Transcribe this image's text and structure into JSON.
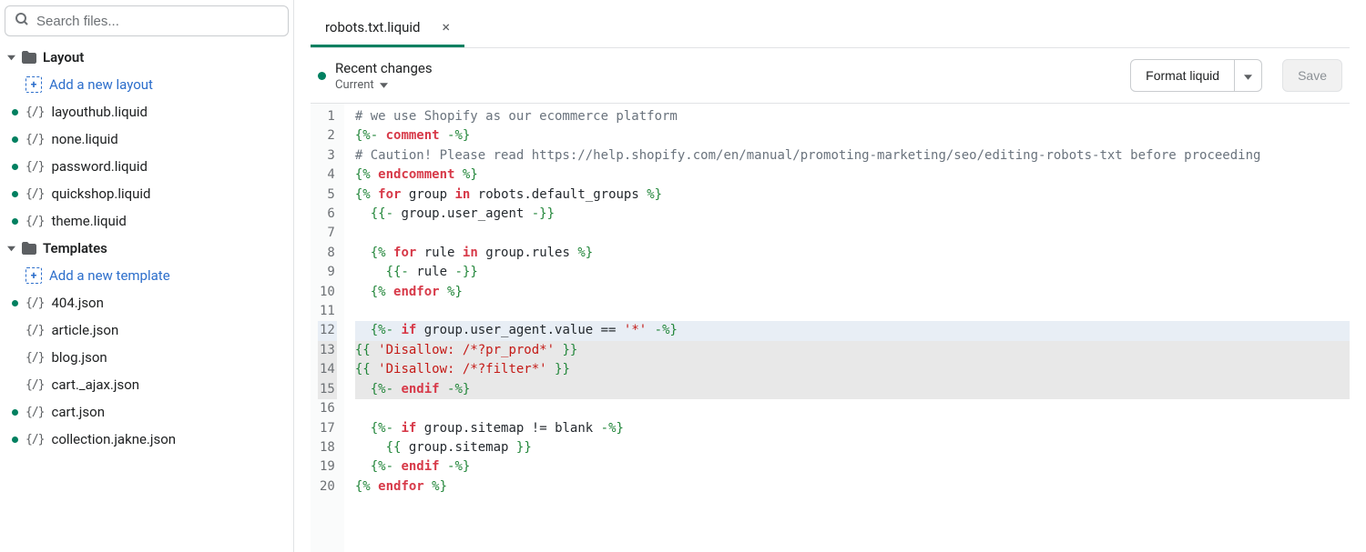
{
  "search": {
    "placeholder": "Search files..."
  },
  "sidebar": {
    "groups": [
      {
        "title": "Layout",
        "add_label": "Add a new layout",
        "items": [
          {
            "label": "layouthub.liquid",
            "modified": true
          },
          {
            "label": "none.liquid",
            "modified": true
          },
          {
            "label": "password.liquid",
            "modified": true
          },
          {
            "label": "quickshop.liquid",
            "modified": true
          },
          {
            "label": "theme.liquid",
            "modified": true
          }
        ]
      },
      {
        "title": "Templates",
        "add_label": "Add a new template",
        "items": [
          {
            "label": "404.json",
            "modified": true
          },
          {
            "label": "article.json",
            "modified": false
          },
          {
            "label": "blog.json",
            "modified": false
          },
          {
            "label": "cart._ajax.json",
            "modified": false
          },
          {
            "label": "cart.json",
            "modified": true
          },
          {
            "label": "collection.jakne.json",
            "modified": true
          }
        ]
      }
    ]
  },
  "tab": {
    "label": "robots.txt.liquid"
  },
  "toolbar": {
    "changes_label": "Recent changes",
    "version_label": "Current",
    "format_label": "Format liquid",
    "save_label": "Save"
  },
  "code": {
    "start_line": 1,
    "highlighted": [
      12
    ],
    "selected": [
      13,
      14,
      15
    ],
    "lines": [
      [
        {
          "t": "comment",
          "v": "# we use Shopify as our ecommerce platform"
        }
      ],
      [
        {
          "t": "tag",
          "v": "{%-"
        },
        {
          "t": "plain",
          "v": " "
        },
        {
          "t": "kw",
          "v": "comment"
        },
        {
          "t": "plain",
          "v": " "
        },
        {
          "t": "tag",
          "v": "-%}"
        }
      ],
      [
        {
          "t": "comment",
          "v": "# Caution! Please read https://help.shopify.com/en/manual/promoting-marketing/seo/editing-robots-txt before proceeding"
        }
      ],
      [
        {
          "t": "tag",
          "v": "{%"
        },
        {
          "t": "plain",
          "v": " "
        },
        {
          "t": "kw",
          "v": "endcomment"
        },
        {
          "t": "plain",
          "v": " "
        },
        {
          "t": "tag",
          "v": "%}"
        }
      ],
      [
        {
          "t": "tag",
          "v": "{%"
        },
        {
          "t": "plain",
          "v": " "
        },
        {
          "t": "kw",
          "v": "for"
        },
        {
          "t": "plain",
          "v": " "
        },
        {
          "t": "id",
          "v": "group"
        },
        {
          "t": "plain",
          "v": " "
        },
        {
          "t": "kw",
          "v": "in"
        },
        {
          "t": "plain",
          "v": " "
        },
        {
          "t": "id",
          "v": "robots.default_groups"
        },
        {
          "t": "plain",
          "v": " "
        },
        {
          "t": "tag",
          "v": "%}"
        }
      ],
      [
        {
          "t": "plain",
          "v": "  "
        },
        {
          "t": "tag",
          "v": "{{-"
        },
        {
          "t": "plain",
          "v": " "
        },
        {
          "t": "id",
          "v": "group.user_agent"
        },
        {
          "t": "plain",
          "v": " "
        },
        {
          "t": "tag",
          "v": "-}}"
        }
      ],
      [],
      [
        {
          "t": "plain",
          "v": "  "
        },
        {
          "t": "tag",
          "v": "{%"
        },
        {
          "t": "plain",
          "v": " "
        },
        {
          "t": "kw",
          "v": "for"
        },
        {
          "t": "plain",
          "v": " "
        },
        {
          "t": "id",
          "v": "rule"
        },
        {
          "t": "plain",
          "v": " "
        },
        {
          "t": "kw",
          "v": "in"
        },
        {
          "t": "plain",
          "v": " "
        },
        {
          "t": "id",
          "v": "group.rules"
        },
        {
          "t": "plain",
          "v": " "
        },
        {
          "t": "tag",
          "v": "%}"
        }
      ],
      [
        {
          "t": "plain",
          "v": "    "
        },
        {
          "t": "tag",
          "v": "{{-"
        },
        {
          "t": "plain",
          "v": " "
        },
        {
          "t": "id",
          "v": "rule"
        },
        {
          "t": "plain",
          "v": " "
        },
        {
          "t": "tag",
          "v": "-}}"
        }
      ],
      [
        {
          "t": "plain",
          "v": "  "
        },
        {
          "t": "tag",
          "v": "{%"
        },
        {
          "t": "plain",
          "v": " "
        },
        {
          "t": "kw",
          "v": "endfor"
        },
        {
          "t": "plain",
          "v": " "
        },
        {
          "t": "tag",
          "v": "%}"
        }
      ],
      [],
      [
        {
          "t": "plain",
          "v": "  "
        },
        {
          "t": "tag",
          "v": "{%-"
        },
        {
          "t": "plain",
          "v": " "
        },
        {
          "t": "kw",
          "v": "if"
        },
        {
          "t": "plain",
          "v": " "
        },
        {
          "t": "id",
          "v": "group.user_agent.value"
        },
        {
          "t": "plain",
          "v": " "
        },
        {
          "t": "op",
          "v": "=="
        },
        {
          "t": "plain",
          "v": " "
        },
        {
          "t": "str",
          "v": "'*'"
        },
        {
          "t": "plain",
          "v": " "
        },
        {
          "t": "tag",
          "v": "-%}"
        }
      ],
      [
        {
          "t": "tag",
          "v": "{{"
        },
        {
          "t": "plain",
          "v": " "
        },
        {
          "t": "str",
          "v": "'Disallow: /*?pr_prod*'"
        },
        {
          "t": "plain",
          "v": " "
        },
        {
          "t": "tag",
          "v": "}}"
        }
      ],
      [
        {
          "t": "tag",
          "v": "{{"
        },
        {
          "t": "plain",
          "v": " "
        },
        {
          "t": "str",
          "v": "'Disallow: /*?filter*'"
        },
        {
          "t": "plain",
          "v": " "
        },
        {
          "t": "tag",
          "v": "}}"
        }
      ],
      [
        {
          "t": "plain",
          "v": "  "
        },
        {
          "t": "tag",
          "v": "{%-"
        },
        {
          "t": "plain",
          "v": " "
        },
        {
          "t": "kw",
          "v": "endif"
        },
        {
          "t": "plain",
          "v": " "
        },
        {
          "t": "tag",
          "v": "-%}"
        }
      ],
      [],
      [
        {
          "t": "plain",
          "v": "  "
        },
        {
          "t": "tag",
          "v": "{%-"
        },
        {
          "t": "plain",
          "v": " "
        },
        {
          "t": "kw",
          "v": "if"
        },
        {
          "t": "plain",
          "v": " "
        },
        {
          "t": "id",
          "v": "group.sitemap"
        },
        {
          "t": "plain",
          "v": " "
        },
        {
          "t": "op",
          "v": "!="
        },
        {
          "t": "plain",
          "v": " "
        },
        {
          "t": "id",
          "v": "blank"
        },
        {
          "t": "plain",
          "v": " "
        },
        {
          "t": "tag",
          "v": "-%}"
        }
      ],
      [
        {
          "t": "plain",
          "v": "    "
        },
        {
          "t": "tag",
          "v": "{{"
        },
        {
          "t": "plain",
          "v": " "
        },
        {
          "t": "id",
          "v": "group.sitemap"
        },
        {
          "t": "plain",
          "v": " "
        },
        {
          "t": "tag",
          "v": "}}"
        }
      ],
      [
        {
          "t": "plain",
          "v": "  "
        },
        {
          "t": "tag",
          "v": "{%-"
        },
        {
          "t": "plain",
          "v": " "
        },
        {
          "t": "kw",
          "v": "endif"
        },
        {
          "t": "plain",
          "v": " "
        },
        {
          "t": "tag",
          "v": "-%}"
        }
      ],
      [
        {
          "t": "tag",
          "v": "{%"
        },
        {
          "t": "plain",
          "v": " "
        },
        {
          "t": "kw",
          "v": "endfor"
        },
        {
          "t": "plain",
          "v": " "
        },
        {
          "t": "tag",
          "v": "%}"
        }
      ]
    ]
  }
}
